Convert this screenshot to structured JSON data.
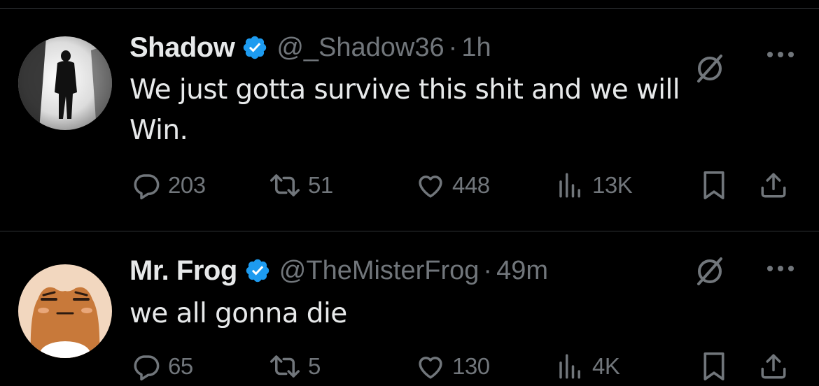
{
  "tweets": [
    {
      "display_name": "Shadow",
      "handle": "@_Shadow36",
      "separator": "·",
      "time": "1h",
      "text": "We just gotta survive this shit and we will Win.",
      "replies": "203",
      "retweets": "51",
      "likes": "448",
      "views": "13K"
    },
    {
      "display_name": "Mr. Frog",
      "handle": "@TheMisterFrog",
      "separator": "·",
      "time": "49m",
      "text": "we all gonna die",
      "replies": "65",
      "retweets": "5",
      "likes": "130",
      "views": "4K"
    }
  ],
  "icons": {
    "verified": "verified-badge-icon",
    "grok": "grok-icon",
    "more": "more-dots-icon",
    "reply": "reply-bubble-icon",
    "retweet": "retweet-icon",
    "like": "heart-icon",
    "views": "views-bar-chart-icon",
    "bookmark": "bookmark-icon",
    "share": "share-upload-icon"
  },
  "colors": {
    "background": "#000000",
    "text_primary": "#e7e9ea",
    "text_secondary": "#71767b",
    "verified_blue": "#1d9bf0",
    "divider": "#2f3336"
  }
}
